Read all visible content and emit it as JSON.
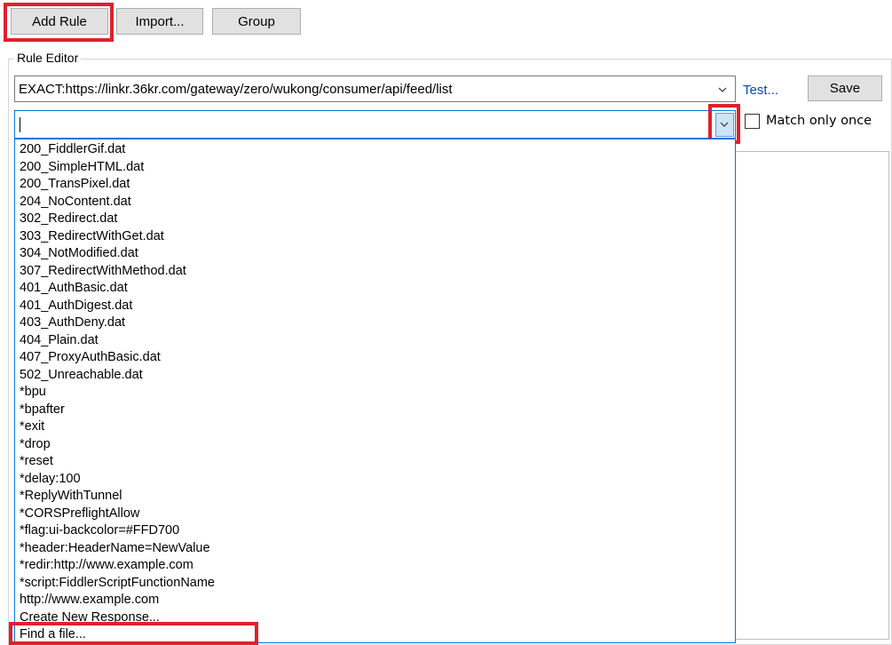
{
  "toolbar": {
    "add_rule_label": "Add Rule",
    "import_label": "Import...",
    "group_label": "Group"
  },
  "rule_editor": {
    "legend": "Rule Editor",
    "match_value": "EXACT:https://linkr.36kr.com/gateway/zero/wukong/consumer/api/feed/list",
    "action_value": "",
    "test_link": "Test...",
    "save_label": "Save",
    "match_once_label": "Match only once",
    "match_once_checked": false
  },
  "dropdown": {
    "items": [
      "200_FiddlerGif.dat",
      "200_SimpleHTML.dat",
      "200_TransPixel.dat",
      "204_NoContent.dat",
      "302_Redirect.dat",
      "303_RedirectWithGet.dat",
      "304_NotModified.dat",
      "307_RedirectWithMethod.dat",
      "401_AuthBasic.dat",
      "401_AuthDigest.dat",
      "403_AuthDeny.dat",
      "404_Plain.dat",
      "407_ProxyAuthBasic.dat",
      "502_Unreachable.dat",
      "*bpu",
      "*bpafter",
      "*exit",
      "*drop",
      "*reset",
      "*delay:100",
      "*ReplyWithTunnel",
      "*CORSPreflightAllow",
      "*flag:ui-backcolor=#FFD700",
      "*header:HeaderName=NewValue",
      "*redir:http://www.example.com",
      "*script:FiddlerScriptFunctionName",
      "http://www.example.com",
      "Create New Response...",
      "Find a file..."
    ]
  },
  "colors": {
    "highlight_red": "#e0202a",
    "focus_blue": "#0078d7",
    "link_blue": "#0645ad"
  }
}
